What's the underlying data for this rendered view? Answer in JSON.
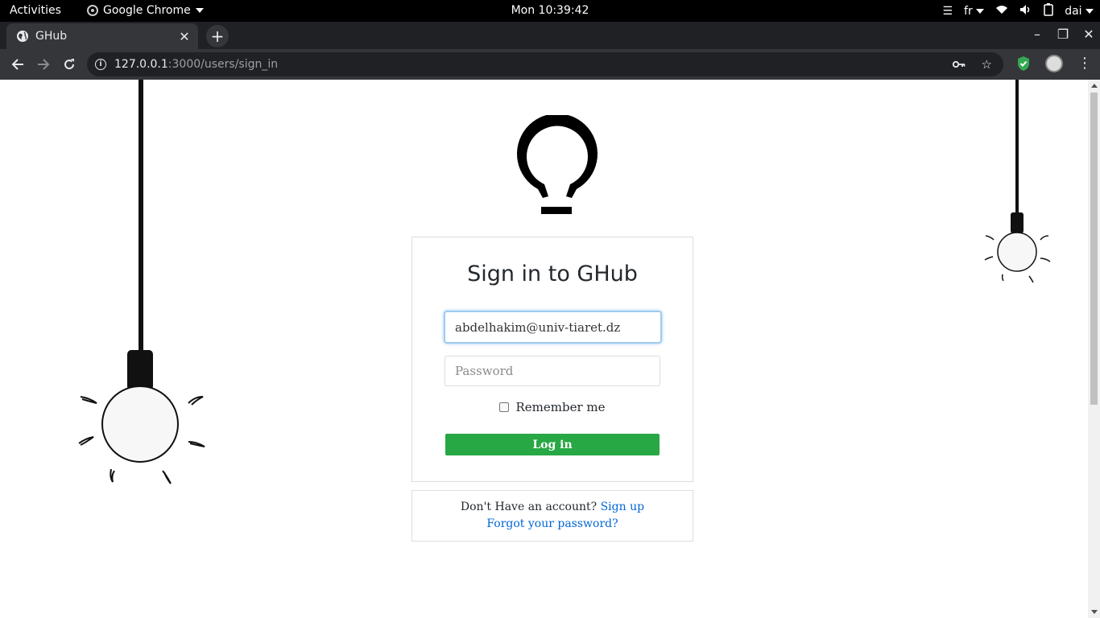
{
  "system_bar": {
    "activities": "Activities",
    "app_name": "Google Chrome",
    "clock": "Mon 10:39:42",
    "keyboard_layout": "fr",
    "user": "dai"
  },
  "browser": {
    "tab_title": "GHub",
    "url_host": "127.0.0.1",
    "url_path": ":3000/users/sign_in",
    "icons": {
      "tab": "globe-icon",
      "back": "back-arrow-icon",
      "forward": "forward-arrow-icon",
      "reload": "reload-icon",
      "site_info": "info-icon",
      "key": "key-icon",
      "bookmark": "star-icon",
      "extension": "shield-icon",
      "menu": "kebab-icon"
    }
  },
  "signin": {
    "title": "Sign in to GHub",
    "email_value": "abdelhakim@univ-tiaret.dz",
    "password_placeholder": "Password",
    "remember_label": "Remember me",
    "login_label": "Log in"
  },
  "footer_box": {
    "no_account_text": "Don't Have an account?",
    "signup_link": "Sign up",
    "forgot_link": "Forgot your password?"
  },
  "colors": {
    "login_button": "#28a745",
    "link": "#0366d6",
    "focus_ring": "#9ecaed",
    "extension_shield": "#34a853"
  }
}
